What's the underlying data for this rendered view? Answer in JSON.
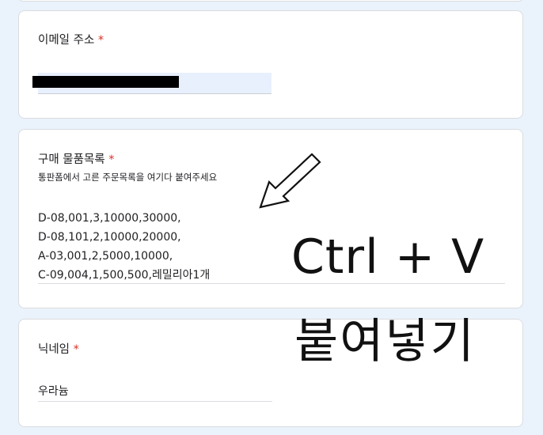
{
  "email_question": {
    "label": "이메일 주소",
    "required_mark": "*"
  },
  "items_question": {
    "label": "구매 물품목록",
    "required_mark": "*",
    "description": "통판폼에서 고른 주문목록을 여기다 붙여주세요",
    "value_lines": [
      "D-08,001,3,10000,30000,",
      "D-08,101,2,10000,20000,",
      "A-03,001,2,5000,10000,",
      "C-09,004,1,500,500,레밀리아1개"
    ]
  },
  "nickname_question": {
    "label": "닉네임",
    "required_mark": "*",
    "value": "우라늄"
  },
  "annotation": {
    "shortcut": "Ctrl + V",
    "paste": "붙여넣기",
    "arrow_icon": "arrow-down-left-icon"
  },
  "colors": {
    "background": "#eaf3fb",
    "required": "#d93025",
    "autofill": "#e8f0fe"
  }
}
